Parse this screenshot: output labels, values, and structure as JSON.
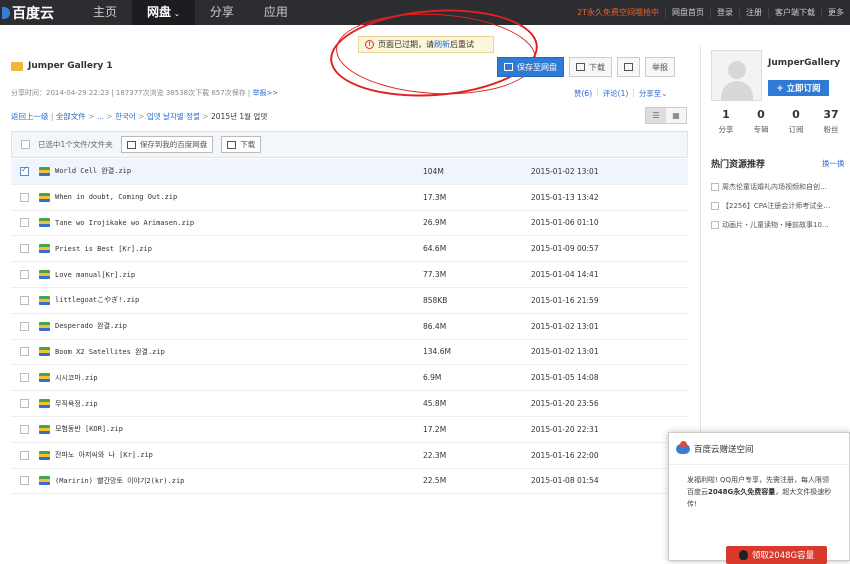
{
  "header": {
    "logo_text": "百度云",
    "nav": [
      {
        "label": "主页",
        "active": false
      },
      {
        "label": "网盘",
        "active": true,
        "caret": "⌄"
      },
      {
        "label": "分享",
        "active": false
      },
      {
        "label": "应用",
        "active": false
      }
    ],
    "right_links": [
      "2T永久免费空间哦抢中",
      "网盘首页",
      "登录",
      "注册",
      "客户端下载",
      "更多"
    ]
  },
  "alert": {
    "text_before": "页面已过期，请",
    "link": "刷新",
    "text_after": "后重试"
  },
  "folder": {
    "title": "Jumper Gallery 1",
    "meta_prefix": "分享时间：2014-04-29 22:23 | 187377次浏览 38538次下载 657次保存 |",
    "report_link": "举报>>"
  },
  "actions": {
    "save_label": "保存至网盘",
    "download_label": "下载",
    "report_label": "举报"
  },
  "social": {
    "like": "赞(6)",
    "comment": "评论(1)",
    "share": "分享至⌄"
  },
  "breadcrumb": {
    "back": "返回上一级",
    "all": "全部文件",
    "ellipsis": "...",
    "p1": "한국어",
    "p2": "업뎃 날자별 정렬",
    "current": "2015년 1월 업뎃"
  },
  "toolbar": {
    "selected_text": "已选中1个文件/文件夹",
    "save_btn": "保存到我的百度网盘",
    "download_btn": "下载"
  },
  "files": [
    {
      "name": "World Cell 완결.zip",
      "size": "104M",
      "date": "2015-01-02 13:01",
      "checked": true
    },
    {
      "name": "When in doubt, Coming Out.zip",
      "size": "17.3M",
      "date": "2015-01-13 13:42",
      "checked": false
    },
    {
      "name": "Tane wo Irojikake wo Arimasen.zip",
      "size": "26.9M",
      "date": "2015-01-06 01:10",
      "checked": false
    },
    {
      "name": "Priest is Best [Kr].zip",
      "size": "64.6M",
      "date": "2015-01-09 00:57",
      "checked": false
    },
    {
      "name": "Love manual[Kr].zip",
      "size": "77.3M",
      "date": "2015-01-04 14:41",
      "checked": false
    },
    {
      "name": "littlegoatこやぎ!.zip",
      "size": "858KB",
      "date": "2015-01-16 21:59",
      "checked": false
    },
    {
      "name": "Desperado 완결.zip",
      "size": "86.4M",
      "date": "2015-01-02 13:01",
      "checked": false
    },
    {
      "name": "Boom X2 Satellites 완결.zip",
      "size": "134.6M",
      "date": "2015-01-02 13:01",
      "checked": false
    },
    {
      "name": "시시코마.zip",
      "size": "6.9M",
      "date": "2015-01-05 14:08",
      "checked": false
    },
    {
      "name": "무직욕정.zip",
      "size": "45.8M",
      "date": "2015-01-20 23:56",
      "checked": false
    },
    {
      "name": "모험동반 [KOR].zip",
      "size": "17.2M",
      "date": "2015-01-20 22:31",
      "checked": false
    },
    {
      "name": "잔파노 아저씨와 나 [Kr].zip",
      "size": "22.3M",
      "date": "2015-01-16 22:00",
      "checked": false
    },
    {
      "name": "(Maririn) 빨간망토 이야기2(kr).zip",
      "size": "22.5M",
      "date": "2015-01-08 01:54",
      "checked": false
    }
  ],
  "sidebar": {
    "username": "JumperGallery",
    "subscribe": "+ 立即订阅",
    "stats": [
      {
        "num": "1",
        "label": "分享"
      },
      {
        "num": "0",
        "label": "专辑"
      },
      {
        "num": "0",
        "label": "订阅"
      },
      {
        "num": "37",
        "label": "粉丝"
      }
    ],
    "hot_title": "热门资源推荐",
    "hot_more": "换一换",
    "hot_items": [
      "周杰伦童话婚礼内场视频和自创…",
      "【2256】CPA注册会计师考试全…",
      "动画片・儿童读物・睡前故事10…"
    ]
  },
  "popup": {
    "title": "百度云赠送空间",
    "line1": "发福利啦! QQ用户专享，先需注册，每人限领",
    "line2_prefix": "百度云",
    "line2_bold": "2048G永久免费容量",
    "line2_suffix": "，超大文件极速秒",
    "line3": "传!",
    "claim": "领取2048G容量"
  }
}
